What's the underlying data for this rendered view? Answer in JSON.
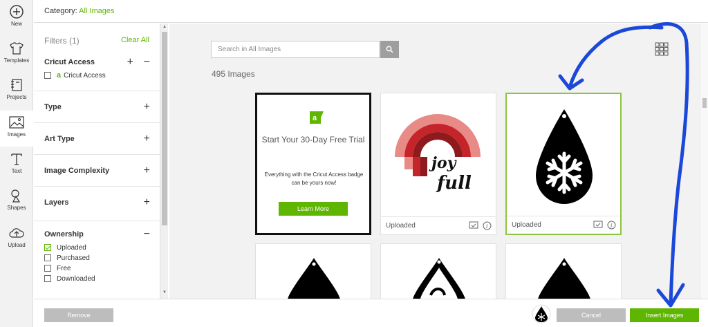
{
  "rail": {
    "items": [
      {
        "label": "New",
        "icon": "plus-circle-icon"
      },
      {
        "label": "Templates",
        "icon": "tshirt-icon"
      },
      {
        "label": "Projects",
        "icon": "notebook-icon"
      },
      {
        "label": "Images",
        "icon": "image-icon"
      },
      {
        "label": "Text",
        "icon": "text-t-icon"
      },
      {
        "label": "Shapes",
        "icon": "shapes-icon"
      },
      {
        "label": "Upload",
        "icon": "cloud-upload-icon"
      }
    ]
  },
  "header": {
    "category_label": "Category:",
    "category_value": "All Images"
  },
  "filters": {
    "title": "Filters (1)",
    "clear_all": "Clear All",
    "cricut_access": {
      "title": "Cricut Access",
      "option": "Cricut Access"
    },
    "sections": [
      "Type",
      "Art Type",
      "Image Complexity",
      "Layers"
    ],
    "ownership": {
      "title": "Ownership",
      "options": [
        {
          "label": "Uploaded",
          "checked": true
        },
        {
          "label": "Purchased",
          "checked": false
        },
        {
          "label": "Free",
          "checked": false
        },
        {
          "label": "Downloaded",
          "checked": false
        }
      ]
    }
  },
  "search": {
    "placeholder": "Search in All Images"
  },
  "results": {
    "count": "495 Images"
  },
  "promo": {
    "title": "Start Your 30-Day Free Trial",
    "text": "Everything with the Cricut Access badge can be yours now!",
    "button": "Learn More"
  },
  "cards": [
    {
      "label": "Uploaded",
      "image": "joy-full-rainbow"
    },
    {
      "label": "Uploaded",
      "image": "snowflake-teardrop",
      "selected": true
    }
  ],
  "footer": {
    "remove": "Remove",
    "cancel": "Cancel",
    "insert": "Insert Images"
  },
  "colors": {
    "accent": "#5eb600",
    "annotation": "#1b48d8",
    "rainbow_outer": "#e88a86",
    "rainbow_mid": "#c4242a",
    "rainbow_inner": "#8e1a1d"
  }
}
